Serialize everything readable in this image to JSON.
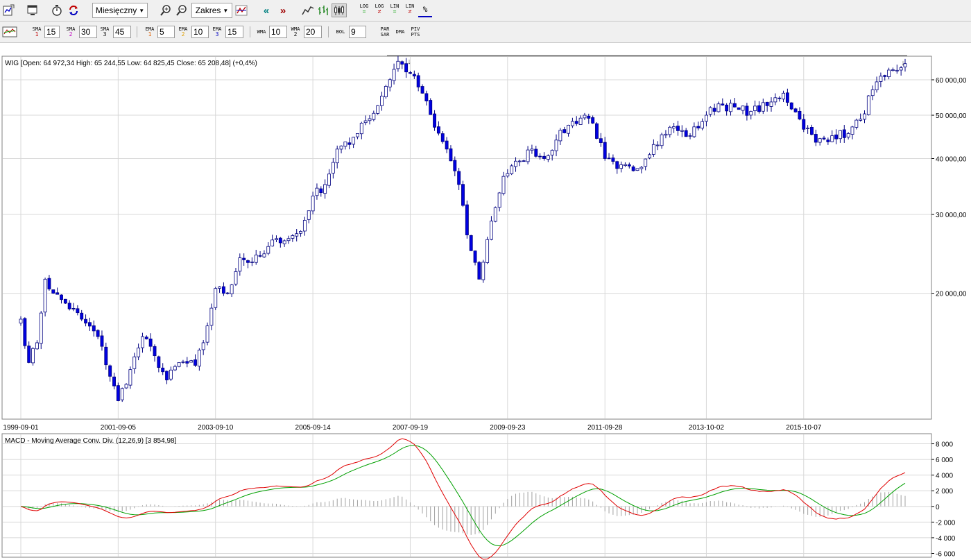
{
  "toolbar": {
    "period_label": "Miesięczny",
    "range_label": "Zakres",
    "scale_buttons": [
      {
        "top": "LOG",
        "bottom": "="
      },
      {
        "top": "LOG",
        "bottom": "≠"
      },
      {
        "top": "LIN",
        "bottom": "="
      },
      {
        "top": "LIN",
        "bottom": "≠"
      },
      {
        "top": "%",
        "bottom": ""
      }
    ],
    "indicators": {
      "sma": [
        {
          "label": "SMA",
          "num": "1",
          "value": "15"
        },
        {
          "label": "SMA",
          "num": "2",
          "value": "30"
        },
        {
          "label": "SMA",
          "num": "3",
          "value": "45"
        }
      ],
      "ema": [
        {
          "label": "EMA",
          "num": "1",
          "value": "5"
        },
        {
          "label": "EMA",
          "num": "2",
          "value": "10"
        },
        {
          "label": "EMA",
          "num": "3",
          "value": "15"
        }
      ],
      "wma": [
        {
          "label": "WMA",
          "num": "",
          "value": "10"
        },
        {
          "label": "WMA",
          "num": "2",
          "value": "20"
        }
      ],
      "bol": {
        "label": "BOL",
        "value": "9"
      },
      "par_sar": "PAR SAR",
      "dma": "DMA",
      "piv_pts": "PIV PTS"
    }
  },
  "colors": {
    "up_candle": "#ffffff",
    "down_candle": "#0000e0",
    "candle_outline": "#000080",
    "macd_line": "#e00000",
    "signal_line": "#00a000",
    "histogram": "#a0a0a0",
    "grid": "#d8d8d8"
  },
  "chart_data": [
    {
      "type": "candlestick",
      "title": "WIG [Open: 64 972,34  High: 65 244,55  Low: 64 825,45  Close: 65 208,48] (+0,4%)",
      "scale": "log",
      "ylim": [
        10500,
        67500
      ],
      "y_ticks": [
        20000,
        30000,
        40000,
        50000,
        60000
      ],
      "y_tick_labels": [
        "20 000,00",
        "30 000,00",
        "40 000,00",
        "50 000,00",
        "60 000,00"
      ],
      "x_tick_labels": [
        "1999-09-01",
        "2001-09-05",
        "2003-09-10",
        "2005-09-14",
        "2007-09-19",
        "2009-09-23",
        "2011-09-28",
        "2013-10-02",
        "2015-10-07"
      ],
      "grid": true,
      "resistance_level": 66000,
      "anchors": [
        [
          "1999-09",
          17500
        ],
        [
          "1999-11",
          14000
        ],
        [
          "2000-01",
          15500
        ],
        [
          "2000-03",
          21500
        ],
        [
          "2000-05",
          20000
        ],
        [
          "2000-08",
          19000
        ],
        [
          "2000-12",
          17500
        ],
        [
          "2001-04",
          16000
        ],
        [
          "2001-09",
          11500
        ],
        [
          "2001-12",
          13500
        ],
        [
          "2002-03",
          16000
        ],
        [
          "2002-06",
          14500
        ],
        [
          "2002-09",
          12800
        ],
        [
          "2002-12",
          14000
        ],
        [
          "2003-04",
          13800
        ],
        [
          "2003-06",
          15500
        ],
        [
          "2003-09",
          20500
        ],
        [
          "2003-12",
          20000
        ],
        [
          "2004-03",
          24000
        ],
        [
          "2004-06",
          23500
        ],
        [
          "2004-09",
          24500
        ],
        [
          "2004-12",
          26500
        ],
        [
          "2005-03",
          26500
        ],
        [
          "2005-06",
          27500
        ],
        [
          "2005-09",
          33000
        ],
        [
          "2005-12",
          35000
        ],
        [
          "2006-03",
          42000
        ],
        [
          "2006-06",
          43000
        ],
        [
          "2006-09",
          48000
        ],
        [
          "2006-12",
          50500
        ],
        [
          "2007-03",
          58000
        ],
        [
          "2007-06",
          66000
        ],
        [
          "2007-09",
          62000
        ],
        [
          "2007-12",
          56000
        ],
        [
          "2008-03",
          47000
        ],
        [
          "2008-06",
          42000
        ],
        [
          "2008-09",
          35000
        ],
        [
          "2008-11",
          27000
        ],
        [
          "2009-02",
          21500
        ],
        [
          "2009-05",
          29000
        ],
        [
          "2009-08",
          36500
        ],
        [
          "2009-12",
          39500
        ],
        [
          "2010-03",
          42000
        ],
        [
          "2010-06",
          40000
        ],
        [
          "2010-09",
          44000
        ],
        [
          "2010-12",
          47500
        ],
        [
          "2011-04",
          50000
        ],
        [
          "2011-06",
          48000
        ],
        [
          "2011-09",
          40000
        ],
        [
          "2011-12",
          38000
        ],
        [
          "2012-05",
          38000
        ],
        [
          "2012-09",
          43000
        ],
        [
          "2013-01",
          47000
        ],
        [
          "2013-06",
          45000
        ],
        [
          "2013-10",
          50000
        ],
        [
          "2014-01",
          53000
        ],
        [
          "2014-06",
          51500
        ],
        [
          "2014-09",
          51000
        ],
        [
          "2015-01",
          52500
        ],
        [
          "2015-05",
          56000
        ],
        [
          "2015-09",
          49000
        ],
        [
          "2016-01",
          43500
        ],
        [
          "2016-05",
          45000
        ],
        [
          "2016-09",
          45500
        ],
        [
          "2016-12",
          49000
        ],
        [
          "2017-03",
          57000
        ],
        [
          "2017-06",
          61000
        ],
        [
          "2017-09",
          63000
        ],
        [
          "2017-11",
          65200
        ]
      ]
    },
    {
      "type": "line",
      "title": "MACD - Moving Average Conv. Div. (12,26,9) [3 854,98]",
      "ylim": [
        -6400,
        9200
      ],
      "y_ticks": [
        -6000,
        -4000,
        -2000,
        0,
        2000,
        4000,
        6000,
        8000
      ],
      "y_tick_labels": [
        "-6 000",
        "-4 000",
        "-2 000",
        "0",
        "2 000",
        "4 000",
        "6 000",
        "8 000"
      ],
      "grid": true,
      "series": [
        {
          "name": "MACD",
          "color": "#e00000",
          "values": []
        },
        {
          "name": "Signal",
          "color": "#00a000",
          "values": []
        }
      ],
      "histogram": "MACD - Signal"
    }
  ]
}
